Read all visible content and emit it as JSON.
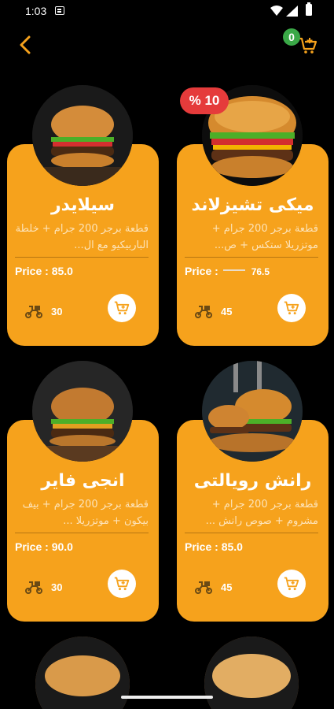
{
  "status_bar": {
    "time": "1:03"
  },
  "header": {
    "cart_count": "0"
  },
  "cards": [
    {
      "name": "ميكى تشيزلاند",
      "description": "قطعة برجر 200 جرام + موتزريلا ستكس + ص...",
      "price_label": "Price : ",
      "price": "76.5",
      "old_price_struck": true,
      "discount": "% 10",
      "delivery_time": "45"
    },
    {
      "name": "سيلايدر",
      "description": "قطعة برجر 200 جرام + خلطة الباربيكيو مع ال...",
      "price_label": "Price : ",
      "price": "85.0",
      "delivery_time": "30"
    },
    {
      "name": "رانش رويالتى",
      "description": "قطعة برجر 200 جرام + مشروم + صوص رانش ...",
      "price_label": "Price : ",
      "price": "85.0",
      "delivery_time": "45"
    },
    {
      "name": "انجى فاير",
      "description": "قطعة برجر 200 جرام + بيف بيكون + موتزريلا ...",
      "price_label": "Price : ",
      "price": "90.0",
      "delivery_time": "30"
    }
  ],
  "colors": {
    "card": "#f6a21c",
    "badge": "#e53b3b",
    "cart_badge": "#3aa847",
    "accent": "#f6a21c"
  }
}
